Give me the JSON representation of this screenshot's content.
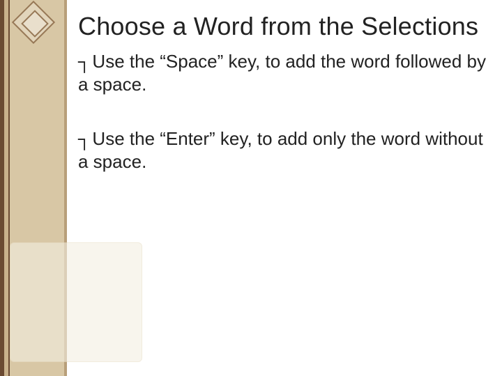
{
  "title": "Choose a Word from the Selections",
  "bullets": [
    {
      "text": "Use the “Space” key, to add the word followed by a space."
    },
    {
      "text": "Use the “Enter” key, to add only the word without a space."
    }
  ],
  "bullet_glyph": "┐",
  "colors": {
    "band_dark": "#6b4a32",
    "band_light": "#d8c7a5",
    "pale_box": "#f4efe2"
  }
}
